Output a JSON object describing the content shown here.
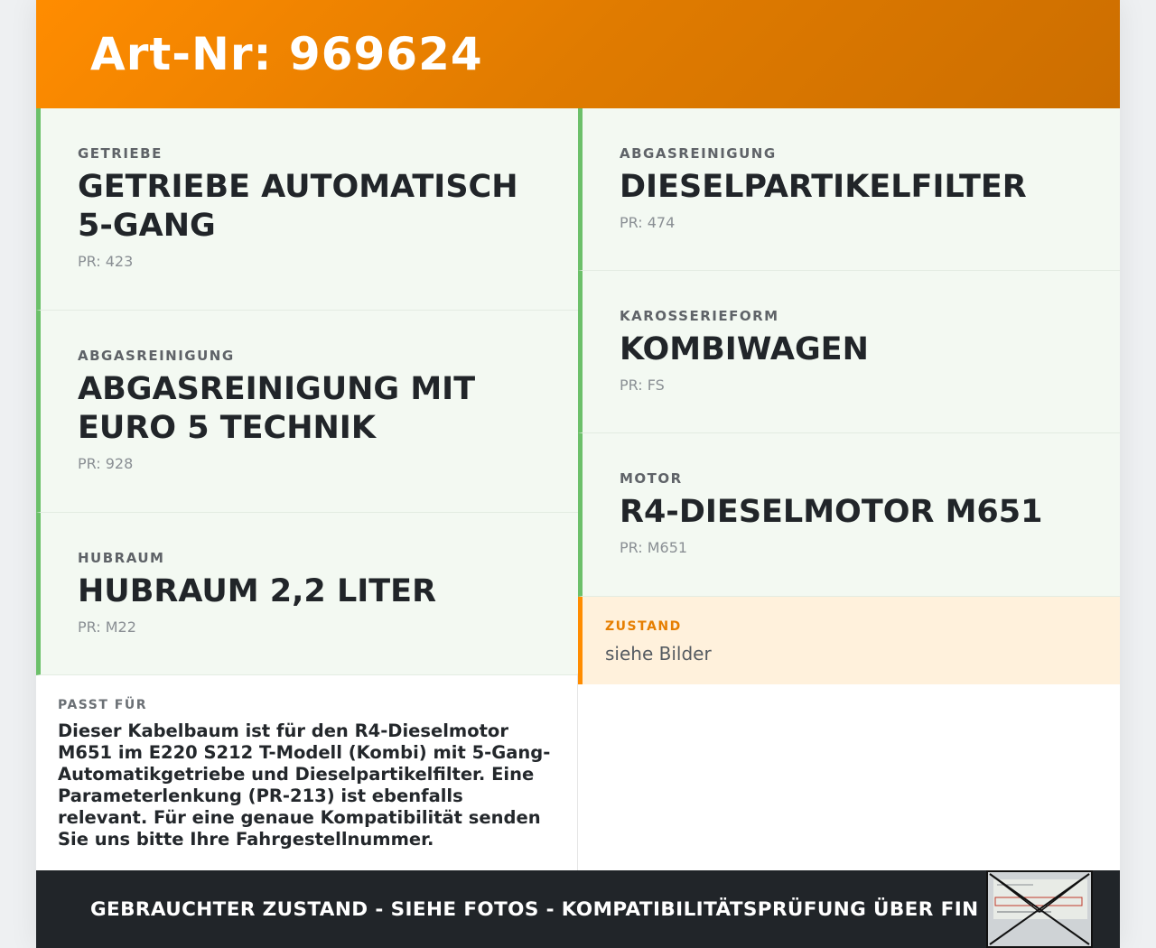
{
  "header": {
    "title": "Art-Nr: 969624"
  },
  "specs_left": [
    {
      "label": "Getriebe",
      "value": "Getriebe automatisch 5-Gang",
      "pr": "PR: 423"
    },
    {
      "label": "Abgasreinigung",
      "value": "Abgasreinigung mit Euro 5 Technik",
      "pr": "PR: 928"
    },
    {
      "label": "Hubraum",
      "value": "Hubraum 2,2 Liter",
      "pr": "PR: M22"
    }
  ],
  "specs_right": [
    {
      "label": "Abgasreinigung",
      "value": "Dieselpartikelfilter",
      "pr": "PR: 474"
    },
    {
      "label": "Karosserieform",
      "value": "Kombiwagen",
      "pr": "PR: FS"
    },
    {
      "label": "Motor",
      "value": "R4-Dieselmotor M651",
      "pr": "PR: M651"
    }
  ],
  "zustand": {
    "label": "Zustand",
    "value": "siehe Bilder"
  },
  "fits": {
    "label": "Passt für",
    "text": "Dieser Kabelbaum ist für den R4-Dieselmotor M651 im E220 S212 T-Modell (Kombi) mit 5-Gang-Automatikgetriebe und Dieselpartikelfilter. Eine Parameterlenkung (PR-213) ist ebenfalls relevant. Für eine genaue Kompatibilität senden Sie uns bitte Ihre Fahrgestellnummer."
  },
  "footer": {
    "note": "Gebrauchter Zustand - siehe Fotos - Kompatibilitätsprüfung über FIN"
  },
  "colors": {
    "header_orange": "#ff8c00",
    "spec_green": "#6cc06a",
    "footer_dark": "#212529"
  }
}
